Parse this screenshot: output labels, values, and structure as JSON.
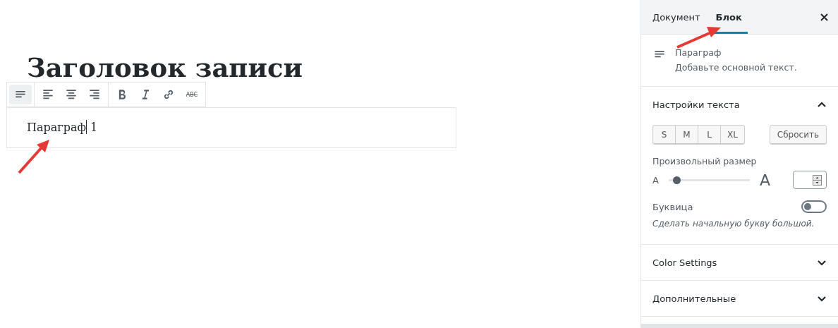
{
  "editor": {
    "post_title": "Заголовок записи",
    "toolbar": [
      [
        {
          "kind": "paragraph",
          "selected": true
        }
      ],
      [
        {
          "kind": "align-left",
          "selected": false
        },
        {
          "kind": "align-center",
          "selected": false
        },
        {
          "kind": "align-right",
          "selected": false
        }
      ],
      [
        {
          "kind": "bold",
          "selected": false
        },
        {
          "kind": "italic",
          "selected": false
        },
        {
          "kind": "link",
          "selected": false
        },
        {
          "kind": "strikethrough",
          "label": "ABC",
          "selected": false
        }
      ]
    ],
    "paragraph": {
      "before_cursor": "Параграф",
      "after_cursor": " 1"
    }
  },
  "sidebar": {
    "tabs": [
      {
        "label": "Документ",
        "selected": false
      },
      {
        "label": "Блок",
        "selected": true
      }
    ],
    "block": {
      "name": "Параграф",
      "description": "Добавьте основной текст."
    },
    "panels": [
      {
        "title": "Настройки текста",
        "expanded": true
      },
      {
        "title": "Color Settings",
        "expanded": false
      },
      {
        "title": "Дополнительные",
        "expanded": false
      }
    ],
    "text_settings": {
      "sizes": [
        {
          "label": "S",
          "selected": false
        },
        {
          "label": "M",
          "selected": false
        },
        {
          "label": "L",
          "selected": false
        },
        {
          "label": "XL",
          "selected": false
        }
      ],
      "reset": "Сбросить",
      "custom_size_label": "Произвольный размер",
      "small_a": "A",
      "large_a": "A",
      "slider": {
        "level": 0.1
      },
      "drop_cap": {
        "label": "Буквица",
        "on": false,
        "help": "Сделать начальную букву большой."
      }
    }
  }
}
